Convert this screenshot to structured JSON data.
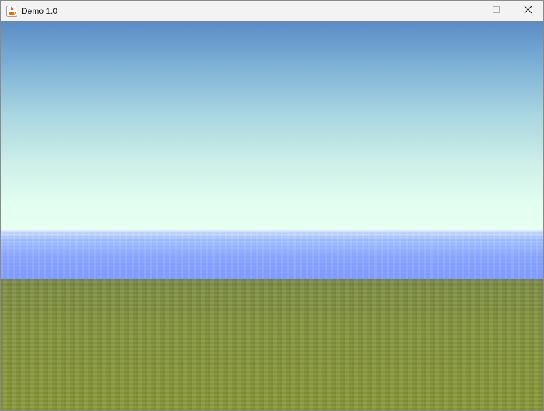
{
  "window": {
    "title": "Demo 1.0",
    "icon": "java-cup-icon",
    "controls": [
      "minimize-icon",
      "maximize-icon",
      "close-icon"
    ]
  },
  "scene": {
    "colors": {
      "sky_top": "#5a8cc6",
      "sky_horizon": "#e6fff2",
      "water": "#8aa6ff",
      "grass": "#86963f"
    }
  }
}
